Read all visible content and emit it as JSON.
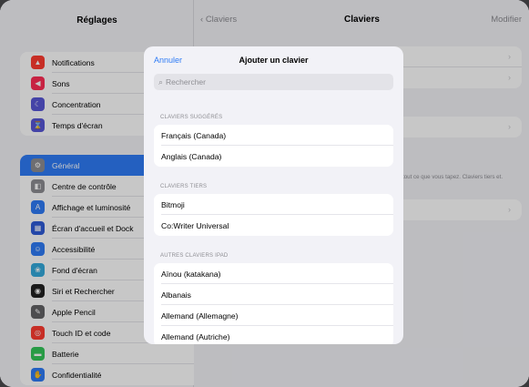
{
  "sidebar": {
    "title": "Réglages",
    "group1": [
      {
        "label": "Notifications",
        "icon": "bell-icon",
        "color": "#ff3b30",
        "glyph": "▲"
      },
      {
        "label": "Sons",
        "icon": "speaker-icon",
        "color": "#ff2d55",
        "glyph": "◀"
      },
      {
        "label": "Concentration",
        "icon": "moon-icon",
        "color": "#5856d6",
        "glyph": "☾"
      },
      {
        "label": "Temps d'écran",
        "icon": "hourglass-icon",
        "color": "#5856d6",
        "glyph": "⌛"
      }
    ],
    "group2": [
      {
        "label": "Général",
        "icon": "gear-icon",
        "color": "#8e8e93",
        "glyph": "⚙",
        "active": true
      },
      {
        "label": "Centre de contrôle",
        "icon": "control-center-icon",
        "color": "#8e8e93",
        "glyph": "◧"
      },
      {
        "label": "Affichage et luminosité",
        "icon": "display-icon",
        "color": "#2f7cf6",
        "glyph": "A"
      },
      {
        "label": "Écran d'accueil et Dock",
        "icon": "home-screen-icon",
        "color": "#2f5bd8",
        "glyph": "▦"
      },
      {
        "label": "Accessibilité",
        "icon": "accessibility-icon",
        "color": "#2f7cf6",
        "glyph": "☺"
      },
      {
        "label": "Fond d'écran",
        "icon": "wallpaper-icon",
        "color": "#34aadc",
        "glyph": "❀"
      },
      {
        "label": "Siri et Rechercher",
        "icon": "siri-icon",
        "color": "#222222",
        "glyph": "◉"
      },
      {
        "label": "Apple Pencil",
        "icon": "pencil-icon",
        "color": "#636366",
        "glyph": "✎"
      },
      {
        "label": "Touch ID et code",
        "icon": "fingerprint-icon",
        "color": "#ff3b30",
        "glyph": "◎"
      },
      {
        "label": "Batterie",
        "icon": "battery-icon",
        "color": "#34c759",
        "glyph": "▬"
      },
      {
        "label": "Confidentialité",
        "icon": "hand-icon",
        "color": "#2f7cf6",
        "glyph": "✋"
      }
    ]
  },
  "detail": {
    "back_label": "Claviers",
    "title": "Claviers",
    "right_label": "Modifier",
    "footnote": "tout ce que vous tapez. Claviers tiers et."
  },
  "modal": {
    "cancel_label": "Annuler",
    "title": "Ajouter un clavier",
    "search_placeholder": "Rechercher",
    "sections": [
      {
        "header": "CLAVIERS SUGGÉRÉS",
        "items": [
          "Français (Canada)",
          "Anglais (Canada)"
        ]
      },
      {
        "header": "CLAVIERS TIERS",
        "items": [
          "Bitmoji",
          "Co:Writer Universal"
        ]
      },
      {
        "header": "AUTRES CLAVIERS IPAD",
        "items": [
          "Aïnou (katakana)",
          "Albanais",
          "Allemand (Allemagne)",
          "Allemand (Autriche)"
        ]
      }
    ]
  }
}
